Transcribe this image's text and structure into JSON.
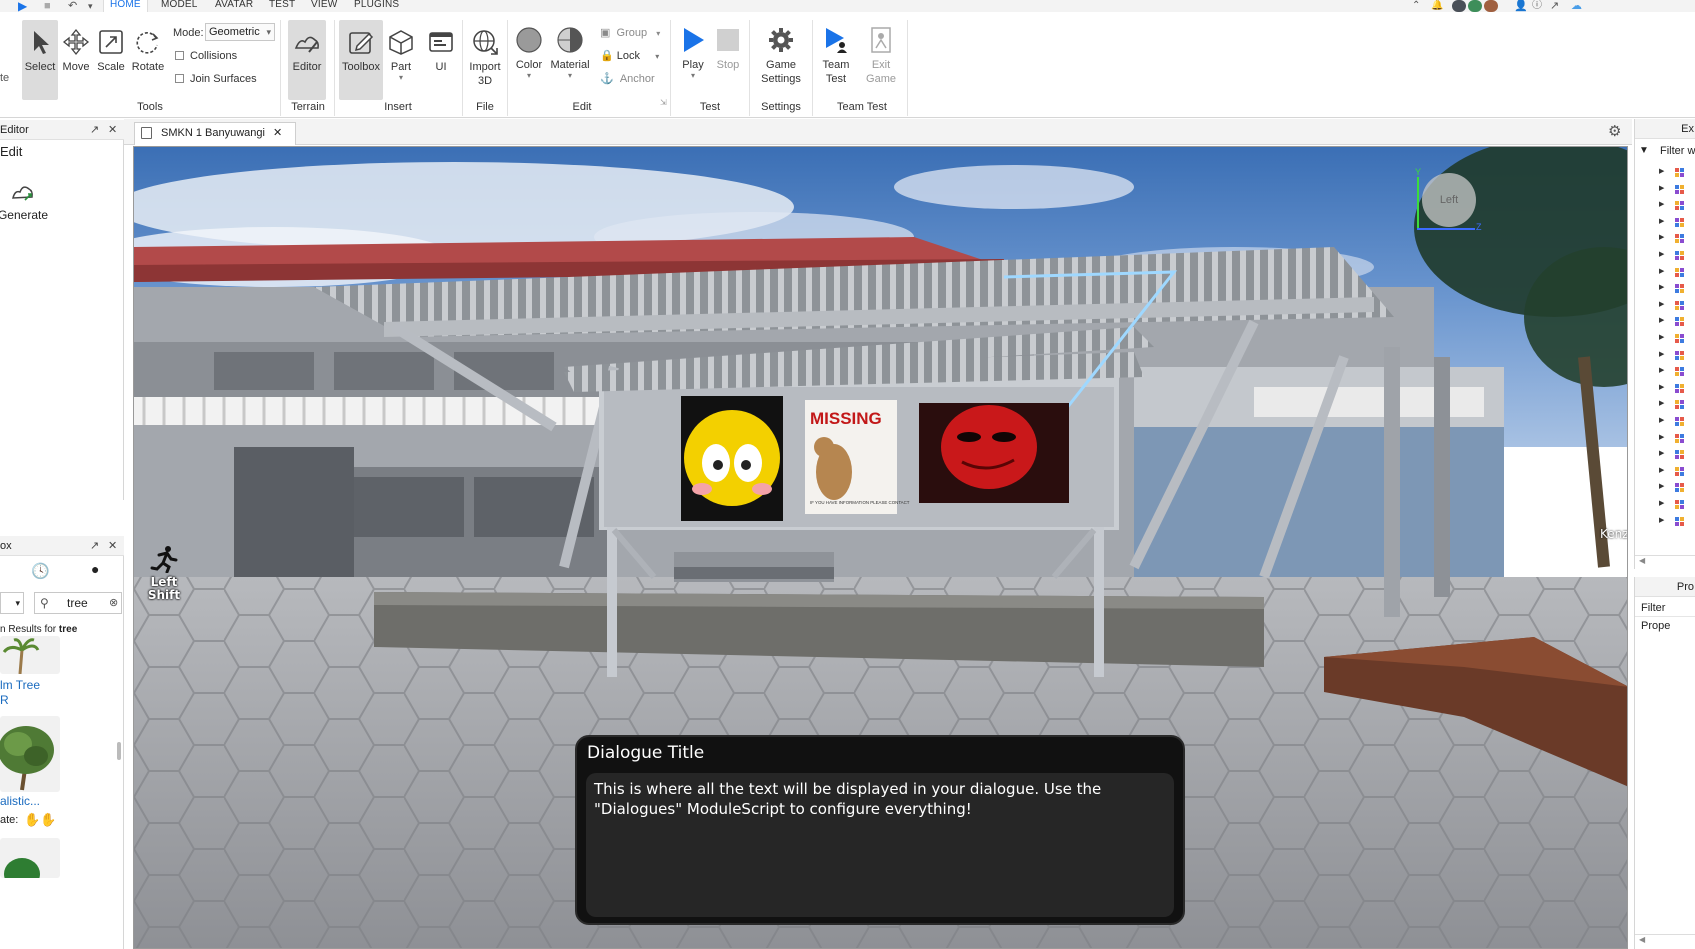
{
  "menubar": {
    "tabs": [
      "HOME",
      "MODEL",
      "AVATAR",
      "TEST",
      "VIEW",
      "PLUGINS"
    ],
    "active_tab": "HOME"
  },
  "ribbon": {
    "tools": {
      "select": "Select",
      "move": "Move",
      "scale": "Scale",
      "rotate": "Rotate",
      "mode_label": "Mode:",
      "mode_value": "Geometric",
      "collisions": "Collisions",
      "join_surfaces": "Join Surfaces",
      "group_label": "Tools"
    },
    "terrain": {
      "editor": "Editor",
      "group_label": "Terrain"
    },
    "insert": {
      "toolbox": "Toolbox",
      "part": "Part",
      "ui": "UI",
      "group_label": "Insert"
    },
    "file": {
      "import_line1": "Import",
      "import_line2": "3D",
      "group_label": "File"
    },
    "edit": {
      "color": "Color",
      "material": "Material",
      "group": "Group",
      "lock": "Lock",
      "anchor": "Anchor",
      "group_label": "Edit"
    },
    "test": {
      "play": "Play",
      "stop": "Stop",
      "group_label": "Test"
    },
    "settings": {
      "line1": "Game",
      "line2": "Settings",
      "group_label": "Settings"
    },
    "team_test": {
      "team_line1": "Team",
      "team_line2": "Test",
      "exit_line1": "Exit",
      "exit_line2": "Game",
      "group_label": "Team Test"
    }
  },
  "left_top_panel": {
    "title": "Editor",
    "subtitle": "Edit",
    "generate": "Generate"
  },
  "left_bottom_panel": {
    "title": "ox",
    "search_value": "tree",
    "results_prefix": "n Results for ",
    "results_query": "tree",
    "item1_line1": "lm Tree",
    "item1_line2": "R",
    "item2_label": "alistic...",
    "item2_rate": "ate:"
  },
  "document_tab": {
    "label": "SMKN 1 Banyuwangi"
  },
  "viewport": {
    "sprint_line1": "Left",
    "sprint_line2": "Shift",
    "gizmo_label": "Left",
    "gizmo_y": "Y",
    "gizmo_z": "Z",
    "player_name": "Kenz",
    "poster_missing": "MISSING",
    "poster_contact": "IF YOU HAVE INFORMATION PLEASE CONTACT"
  },
  "dialogue": {
    "title": "Dialogue Title",
    "text": "This is where all the text will be displayed in your dialogue. Use the \"Dialogues\" ModuleScript to configure everything!"
  },
  "right_top_panel": {
    "title": "Ex",
    "filter": "Filter w"
  },
  "right_bottom_panel": {
    "title": "Pro",
    "filter": "Filter Prope"
  }
}
